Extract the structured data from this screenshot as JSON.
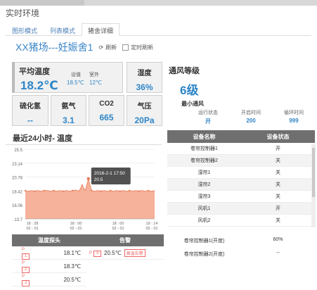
{
  "page_title": "实时环境",
  "tabs": [
    "图形模式",
    "列表模式",
    "猪舍详细"
  ],
  "header": {
    "farm": "XX猪场---妊娠舍1",
    "refresh": "刷新",
    "auto_refresh": "定时刷新"
  },
  "avg_temp": {
    "label": "平均温度",
    "value": "18.2℃",
    "set_label": "设值",
    "set_value": "18.5℃",
    "out_label": "室外",
    "out_value": "12℃"
  },
  "metrics": {
    "humidity": {
      "label": "湿度",
      "value": "36%"
    },
    "h2s": {
      "label": "硫化氢",
      "value": "--"
    },
    "nh3": {
      "label": "氨气",
      "value": "3.1"
    },
    "co2": {
      "label": "CO2",
      "value": "665"
    },
    "pressure": {
      "label": "气压",
      "value": "20Pa"
    }
  },
  "ventilation": {
    "title": "通风等级",
    "level": "6级",
    "mode": "最小通风",
    "stats": [
      {
        "label": "运行状态",
        "value": "开"
      },
      {
        "label": "开启时间",
        "value": "200"
      },
      {
        "label": "循环时间",
        "value": "999"
      }
    ]
  },
  "chart_title": "最近24小时-  温度",
  "chart_data": {
    "type": "area",
    "ylim": [
      13.7,
      25.5
    ],
    "yticks": [
      "25.5",
      "23.14",
      "20.78",
      "18.42",
      "16.06",
      "13.7"
    ],
    "xticks": [
      [
        "18 : 28",
        "02 - 01"
      ],
      [
        "18 : 00",
        "02 - 01"
      ],
      [
        "18 : 00",
        "02 - 01"
      ],
      [
        "19 : 14",
        "02 - 01"
      ]
    ],
    "values": [
      18.5,
      18.4,
      18.5,
      18.4,
      18.5,
      18.4,
      18.5,
      18.5,
      18.4,
      18.5,
      18.4,
      18.5,
      18.4,
      18.5,
      18.4,
      18.5,
      18.6,
      18.4,
      19.4,
      18.5,
      20.5,
      18.5,
      18.4,
      18.5,
      18.4,
      18.5,
      18.4,
      18.5,
      18.4,
      18.5,
      18.4,
      18.5,
      18.4,
      18.5,
      18.4,
      18.5,
      18.4,
      18.5,
      18.4,
      18.5,
      18.4,
      18.5
    ],
    "tooltip": {
      "time": "2016-2-1 17:50",
      "value": "20.5"
    },
    "color": "#f5a58a"
  },
  "devices": {
    "head": [
      "设备名称",
      "设备状态"
    ],
    "rows": [
      [
        "卷帘控制器1",
        "开"
      ],
      [
        "卷帘控制器2",
        "关"
      ],
      [
        "湿帘1",
        "关"
      ],
      [
        "湿帘2",
        "关"
      ],
      [
        "湿帘3",
        "关"
      ],
      [
        "风机1",
        "开"
      ],
      [
        "风机2",
        "关"
      ]
    ],
    "extra": [
      [
        "卷帘控制器1(开度)",
        "60%"
      ],
      [
        "卷帘控制器2(开度)",
        "--"
      ]
    ]
  },
  "probe": {
    "head": "温度探头",
    "rows": [
      [
        "1",
        "18.1℃"
      ],
      [
        "2",
        "18.3℃"
      ],
      [
        "3",
        "20.5℃"
      ]
    ],
    "badge_prefix": "P"
  },
  "alarm": {
    "head": "告警",
    "rows": [
      [
        "3",
        "20.5℃",
        "高温告警"
      ]
    ],
    "badge_prefix": "P"
  }
}
